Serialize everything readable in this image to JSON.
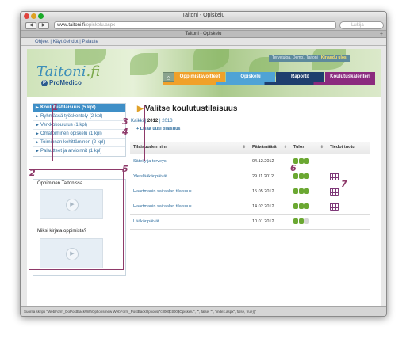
{
  "window": {
    "title": "Taitoni - Opiskelu",
    "url_host": "www.taitoni.fi",
    "url_path": "/opiskelu.aspx",
    "search_placeholder": "Lukija",
    "tab_title": "Taitoni - Opiskelu",
    "bookmarks": "Ohjeet | Käyttöehdot | Palaute"
  },
  "header": {
    "logo_main": "Taitoni",
    "logo_suffix": ".fi",
    "sub_logo": "ProMedico",
    "user_greeting": "Tervetuloa, Demo1 Taitoni",
    "logout": "Kirjaudu ulos",
    "nav": [
      {
        "label": "Oppimistavoitteet"
      },
      {
        "label": "Opiskelu"
      },
      {
        "label": "Raportit"
      },
      {
        "label": "Koulutuskalenteri"
      }
    ]
  },
  "sidebar": {
    "items": [
      {
        "label": "Koulutustilaisuus (5 kpl)"
      },
      {
        "label": "Ryhmässä työskentely (2 kpl)"
      },
      {
        "label": "Verkkokoulutus (1 kpl)"
      },
      {
        "label": "Omatoiminen opiskelu (1 kpl)"
      },
      {
        "label": "Toiminnan kehittäminen (2 kpl)"
      },
      {
        "label": "Palautteet ja arvioinnit (1 kpl)"
      }
    ],
    "video_1_title": "Oppiminen Taitonissa",
    "video_2_title": "Miksi kirjata oppimista?"
  },
  "main": {
    "title": "Valitse koulutustilaisuus",
    "year_all": "Kaikki",
    "year_selected": "2012",
    "year_other": "2013",
    "add_link": "Lisää uusi tilaisuus",
    "columns": {
      "name": "Tilaisuuden nimi",
      "date": "Päivämäärä",
      "result": "Tulos",
      "saved": "Tiedot tuotu"
    },
    "rows": [
      {
        "name": "Säteily ja terveys",
        "date": "04.12.2012",
        "green": 3,
        "cal": false
      },
      {
        "name": "Yleislääkäripäivät",
        "date": "29.11.2012",
        "green": 3,
        "cal": true
      },
      {
        "name": "Haartmanin sairaalan tilaisuus",
        "date": "15.05.2012",
        "green": 3,
        "cal": true
      },
      {
        "name": "Haartmanin sairaalan tilaisuus",
        "date": "14.02.2012",
        "green": 3,
        "cal": true
      },
      {
        "name": "Lääkäripäivät",
        "date": "10.01.2012",
        "green": 2,
        "cal": false
      }
    ]
  },
  "annotations": [
    "1",
    "2",
    "3",
    "4",
    "5",
    "6",
    "7"
  ],
  "status_text": "Suorita skripti \"WebForm_DoPostBackWithOptions(new WebForm_PostBackOptions(\"ctl00$ctl00$Opiskelu\", \"\", false, \"\", \"index.aspx\", false, true))\""
}
